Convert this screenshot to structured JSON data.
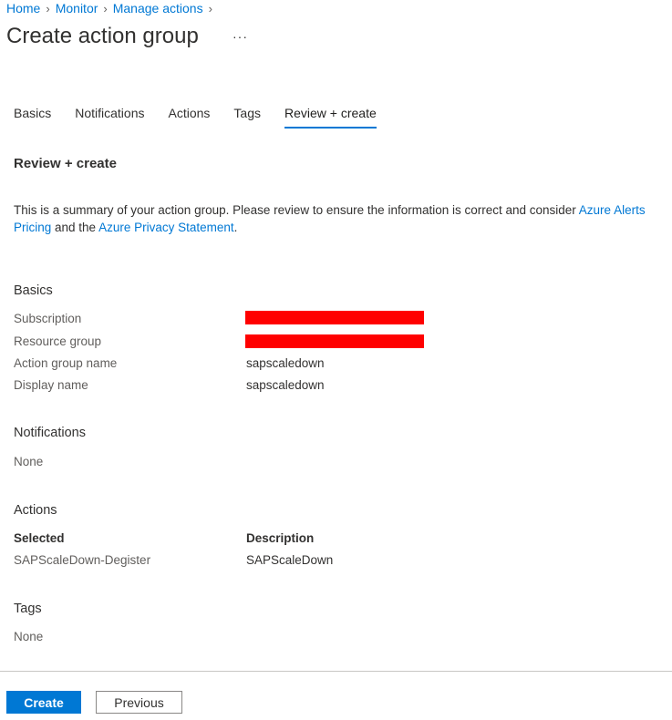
{
  "breadcrumb": {
    "items": [
      {
        "label": "Home"
      },
      {
        "label": "Monitor"
      },
      {
        "label": "Manage actions"
      }
    ],
    "separator": ">"
  },
  "page": {
    "title": "Create action group",
    "more_label": "···"
  },
  "tabs": [
    {
      "label": "Basics",
      "active": false
    },
    {
      "label": "Notifications",
      "active": false
    },
    {
      "label": "Actions",
      "active": false
    },
    {
      "label": "Tags",
      "active": false
    },
    {
      "label": "Review + create",
      "active": true
    }
  ],
  "review": {
    "heading": "Review + create",
    "summary_prefix": "This is a summary of your action group. Please review to ensure the information is correct and consider ",
    "link_pricing": "Azure Alerts Pricing",
    "summary_middle": " and the ",
    "link_privacy": "Azure Privacy Statement",
    "summary_suffix": "."
  },
  "basics": {
    "title": "Basics",
    "rows": [
      {
        "label": "Subscription",
        "value": "",
        "redacted": true
      },
      {
        "label": "Resource group",
        "value": "",
        "redacted": true
      },
      {
        "label": "Action group name",
        "value": "sapscaledown",
        "redacted": false
      },
      {
        "label": "Display name",
        "value": "sapscaledown",
        "redacted": false
      }
    ]
  },
  "notifications": {
    "title": "Notifications",
    "value": "None"
  },
  "actions": {
    "title": "Actions",
    "columns": [
      "Selected",
      "Description"
    ],
    "rows": [
      {
        "selected": "SAPScaleDown-Degister",
        "description": "SAPScaleDown"
      }
    ]
  },
  "tags": {
    "title": "Tags",
    "value": "None"
  },
  "footer": {
    "create_label": "Create",
    "previous_label": "Previous"
  },
  "colors": {
    "accent": "#0078d4",
    "redaction": "#ff0000",
    "text": "#323130"
  }
}
